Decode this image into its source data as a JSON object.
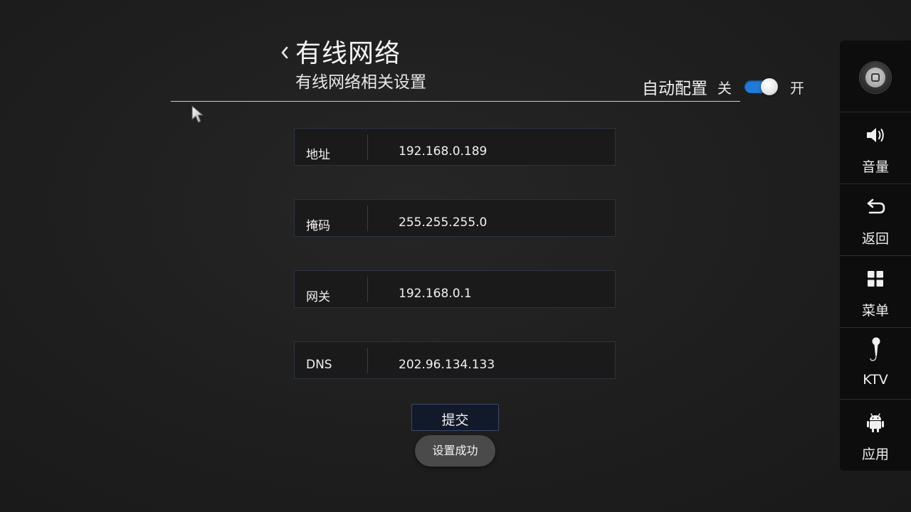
{
  "header": {
    "title": "有线网络",
    "subtitle": "有线网络相关设置",
    "auto_config": {
      "label": "自动配置",
      "off_label": "关",
      "on_label": "开",
      "state": "on"
    }
  },
  "fields": [
    {
      "label": "地址",
      "value": "192.168.0.189"
    },
    {
      "label": "掩码",
      "value": "255.255.255.0"
    },
    {
      "label": "网关",
      "value": "192.168.0.1"
    },
    {
      "label": "DNS",
      "value": "202.96.134.133"
    }
  ],
  "submit_label": "提交",
  "toast_message": "设置成功",
  "side_panel": {
    "items": [
      {
        "label": "音量",
        "icon": "volume-icon"
      },
      {
        "label": "返回",
        "icon": "back-icon"
      },
      {
        "label": "菜单",
        "icon": "menu-grid-icon"
      },
      {
        "label": "KTV",
        "icon": "microphone-icon"
      },
      {
        "label": "应用",
        "icon": "android-icon"
      }
    ]
  },
  "colors": {
    "background": "#1e1e1e",
    "accent": "#1f7bd8",
    "side_panel": "#0d0d0d"
  }
}
